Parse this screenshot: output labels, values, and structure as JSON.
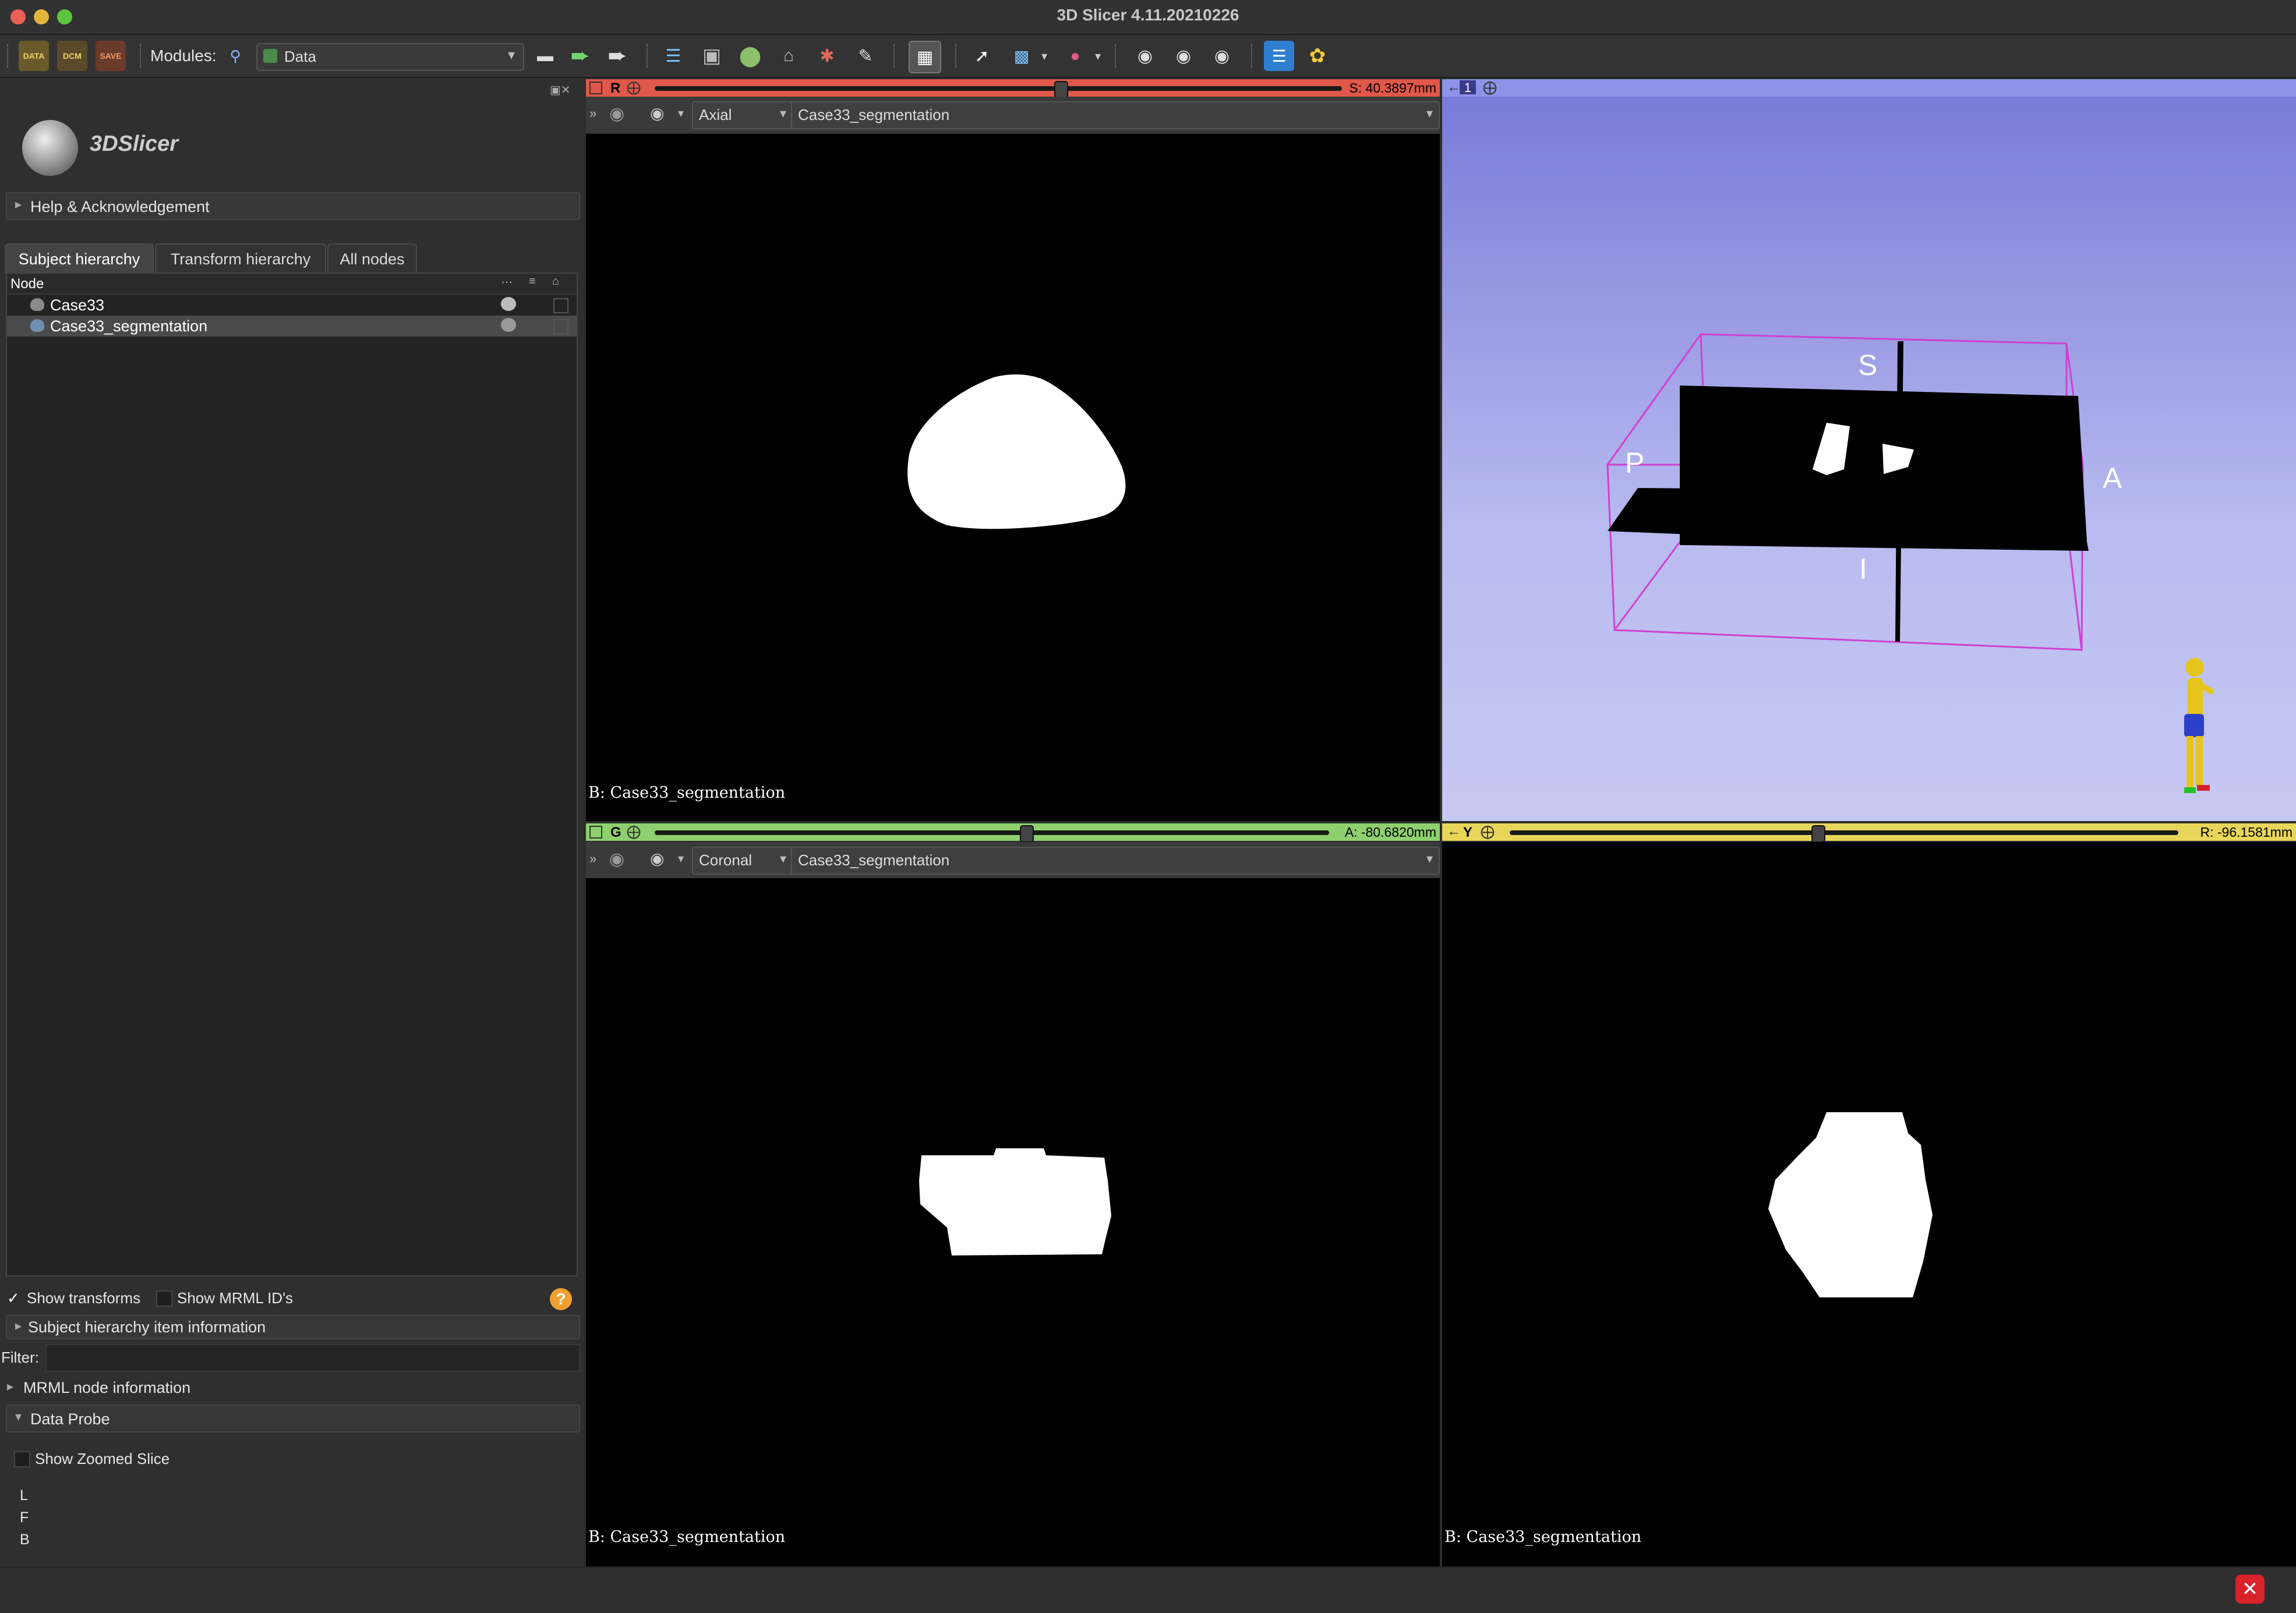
{
  "window": {
    "title": "3D Slicer 4.11.20210226"
  },
  "toolbar": {
    "data_label": "DATA",
    "dcm_label": "DCM",
    "save_label": "SAVE",
    "modules_label": "Modules:",
    "module_selected": "Data"
  },
  "left_panel": {
    "logo_text": "3DSlicer",
    "help_section": "Help & Acknowledgement",
    "tabs": [
      "Subject hierarchy",
      "Transform hierarchy",
      "All nodes"
    ],
    "tree_header": "Node",
    "nodes": [
      "Case33",
      "Case33_segmentation"
    ],
    "show_transforms": "Show transforms",
    "show_mrml_ids": "Show MRML ID's",
    "help_glyph": "?",
    "sh_item_info": "Subject hierarchy item information",
    "filter_label": "Filter:",
    "mrml_node_info": "MRML node information",
    "data_probe": "Data Probe",
    "show_zoomed_slice": "Show Zoomed Slice",
    "probe_rows": [
      "L",
      "F",
      "B"
    ]
  },
  "views": {
    "red": {
      "label": "R",
      "offset": "S: 40.3897mm",
      "orientation": "Axial",
      "background": "Case33_segmentation",
      "corner": "B: Case33_segmentation",
      "slider_fraction": 0.59,
      "color": "#e0584a"
    },
    "threed": {
      "label": "1",
      "color": "#8e93e8"
    },
    "green": {
      "label": "G",
      "offset": "A: -80.6820mm",
      "orientation": "Coronal",
      "background": "Case33_segmentation",
      "corner": "B: Case33_segmentation",
      "slider_fraction": 0.55,
      "color": "#8fd06e"
    },
    "yellow": {
      "label": "Y",
      "offset": "R: -96.1581mm",
      "corner": "B: Case33_segmentation",
      "slider_fraction": 0.46,
      "color": "#e8d65a"
    },
    "orientation_letters": {
      "s": "S",
      "i": "I",
      "p": "P",
      "a": "A"
    }
  },
  "status": {
    "close_glyph": "✕"
  }
}
